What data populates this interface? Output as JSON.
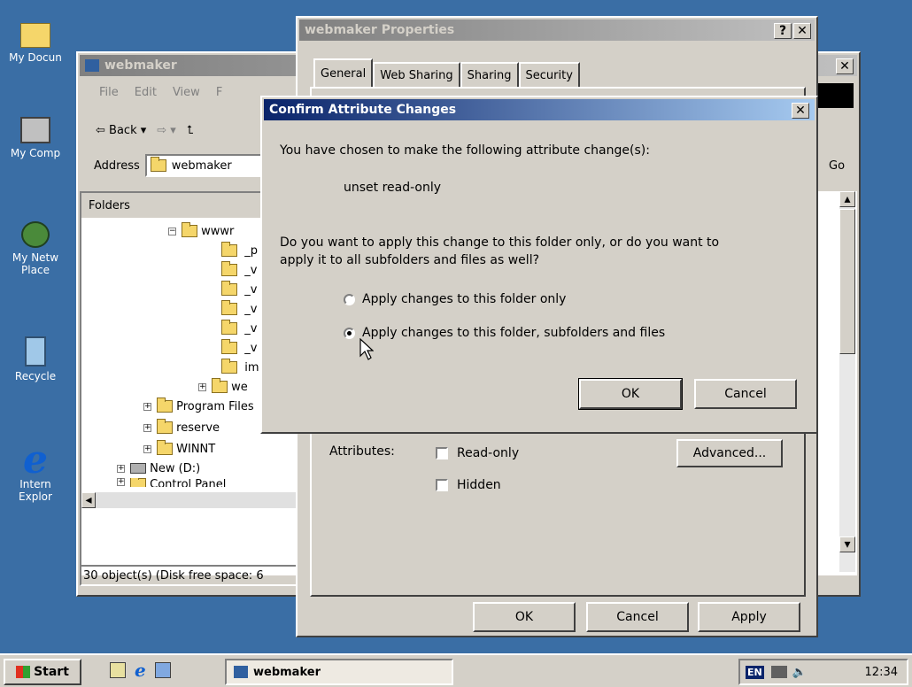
{
  "desktop": {
    "icons": [
      {
        "label": "My Docun"
      },
      {
        "label": "My Comp"
      },
      {
        "label": "My Netw",
        "label2": "Place"
      },
      {
        "label": "Recycle"
      },
      {
        "label": "Intern",
        "label2": "Explor"
      }
    ]
  },
  "explorer": {
    "title": "webmaker",
    "menu": [
      "File",
      "Edit",
      "View",
      "F"
    ],
    "toolbar": {
      "back": "Back"
    },
    "address": {
      "label": "Address",
      "value": "webmaker"
    },
    "go": "Go",
    "folders_header": "Folders",
    "tree": [
      {
        "label": "wwwr"
      },
      {
        "label": "_p"
      },
      {
        "label": "_v"
      },
      {
        "label": "_v"
      },
      {
        "label": "_v"
      },
      {
        "label": "_v"
      },
      {
        "label": "_v"
      },
      {
        "label": "im"
      },
      {
        "label": "we"
      },
      {
        "label": "Program Files"
      },
      {
        "label": "reserve"
      },
      {
        "label": "WINNT"
      },
      {
        "label": "New (D:)"
      },
      {
        "label": "Control Panel"
      }
    ],
    "status": "30 object(s) (Disk free space: 6"
  },
  "properties": {
    "title": "webmaker Properties",
    "tabs": [
      "General",
      "Web Sharing",
      "Sharing",
      "Security"
    ],
    "attributes_label": "Attributes:",
    "readonly_label": "Read-only",
    "hidden_label": "Hidden",
    "advanced_button": "Advanced...",
    "ok": "OK",
    "cancel": "Cancel",
    "apply": "Apply"
  },
  "confirm": {
    "title": "Confirm Attribute Changes",
    "message": "You have chosen to make the following attribute change(s):",
    "change": "unset read-only",
    "question_line1": "Do you want to apply this change to this folder only, or do you want to",
    "question_line2": "apply it to all subfolders and files as well?",
    "option1": "Apply changes to this folder only",
    "option2": "Apply changes to this folder, subfolders and files",
    "selected_option": 2,
    "ok": "OK",
    "cancel": "Cancel"
  },
  "taskbar": {
    "start": "Start",
    "task": "webmaker",
    "lang": "EN",
    "clock": "12:34"
  }
}
